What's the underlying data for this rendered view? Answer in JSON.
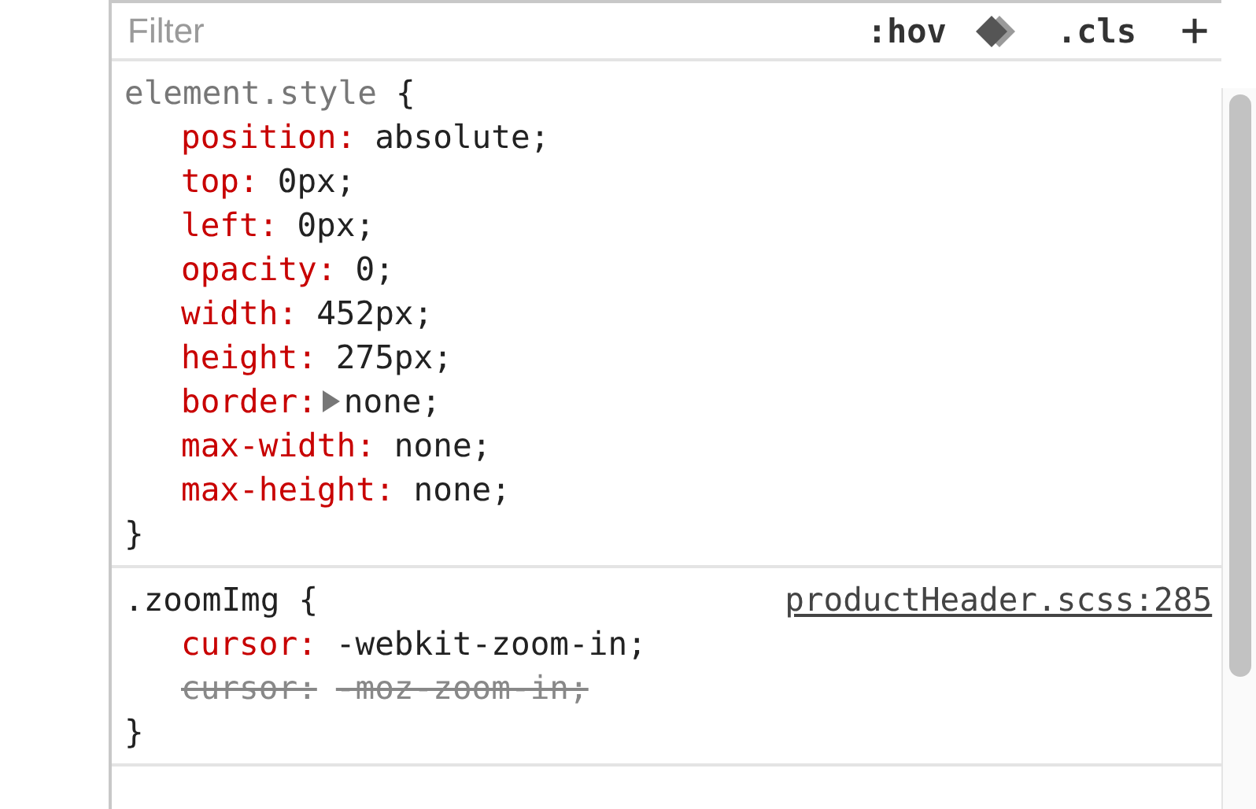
{
  "filter": {
    "placeholder": "Filter"
  },
  "toolbar": [
    {
      "kind": "text",
      "label": ":hov"
    },
    {
      "kind": "icon"
    },
    {
      "kind": "text",
      "label": ".cls"
    },
    {
      "kind": "text",
      "label": "+"
    }
  ],
  "rules": [
    {
      "selector": "element.style",
      "inline": true,
      "open": "{",
      "close": "}",
      "properties": [
        {
          "name": "position:",
          "value": "absolute;",
          "overridden": false,
          "expandable": false
        },
        {
          "name": "top:",
          "value": "0px;",
          "overridden": false,
          "expandable": false
        },
        {
          "name": "left:",
          "value": "0px;",
          "overridden": false,
          "expandable": false
        },
        {
          "name": "opacity:",
          "value": "0;",
          "overridden": false,
          "expandable": false
        },
        {
          "name": "width:",
          "value": "452px;",
          "overridden": false,
          "expandable": false
        },
        {
          "name": "height:",
          "value": "275px;",
          "overridden": false,
          "expandable": false
        },
        {
          "name": "border:",
          "value": "none;",
          "overridden": false,
          "expandable": true
        },
        {
          "name": "max-width:",
          "value": "none;",
          "overridden": false,
          "expandable": false
        },
        {
          "name": "max-height:",
          "value": "none;",
          "overridden": false,
          "expandable": false
        }
      ]
    },
    {
      "selector": ".zoomImg",
      "inline": false,
      "open": "{",
      "close": "}",
      "source": "productHeader.scss:285",
      "properties": [
        {
          "name": "cursor:",
          "value": "-webkit-zoom-in;",
          "overridden": false,
          "expandable": false
        },
        {
          "name": "cursor:",
          "value": "-moz-zoom-in;",
          "overridden": true,
          "expandable": false
        }
      ]
    }
  ]
}
